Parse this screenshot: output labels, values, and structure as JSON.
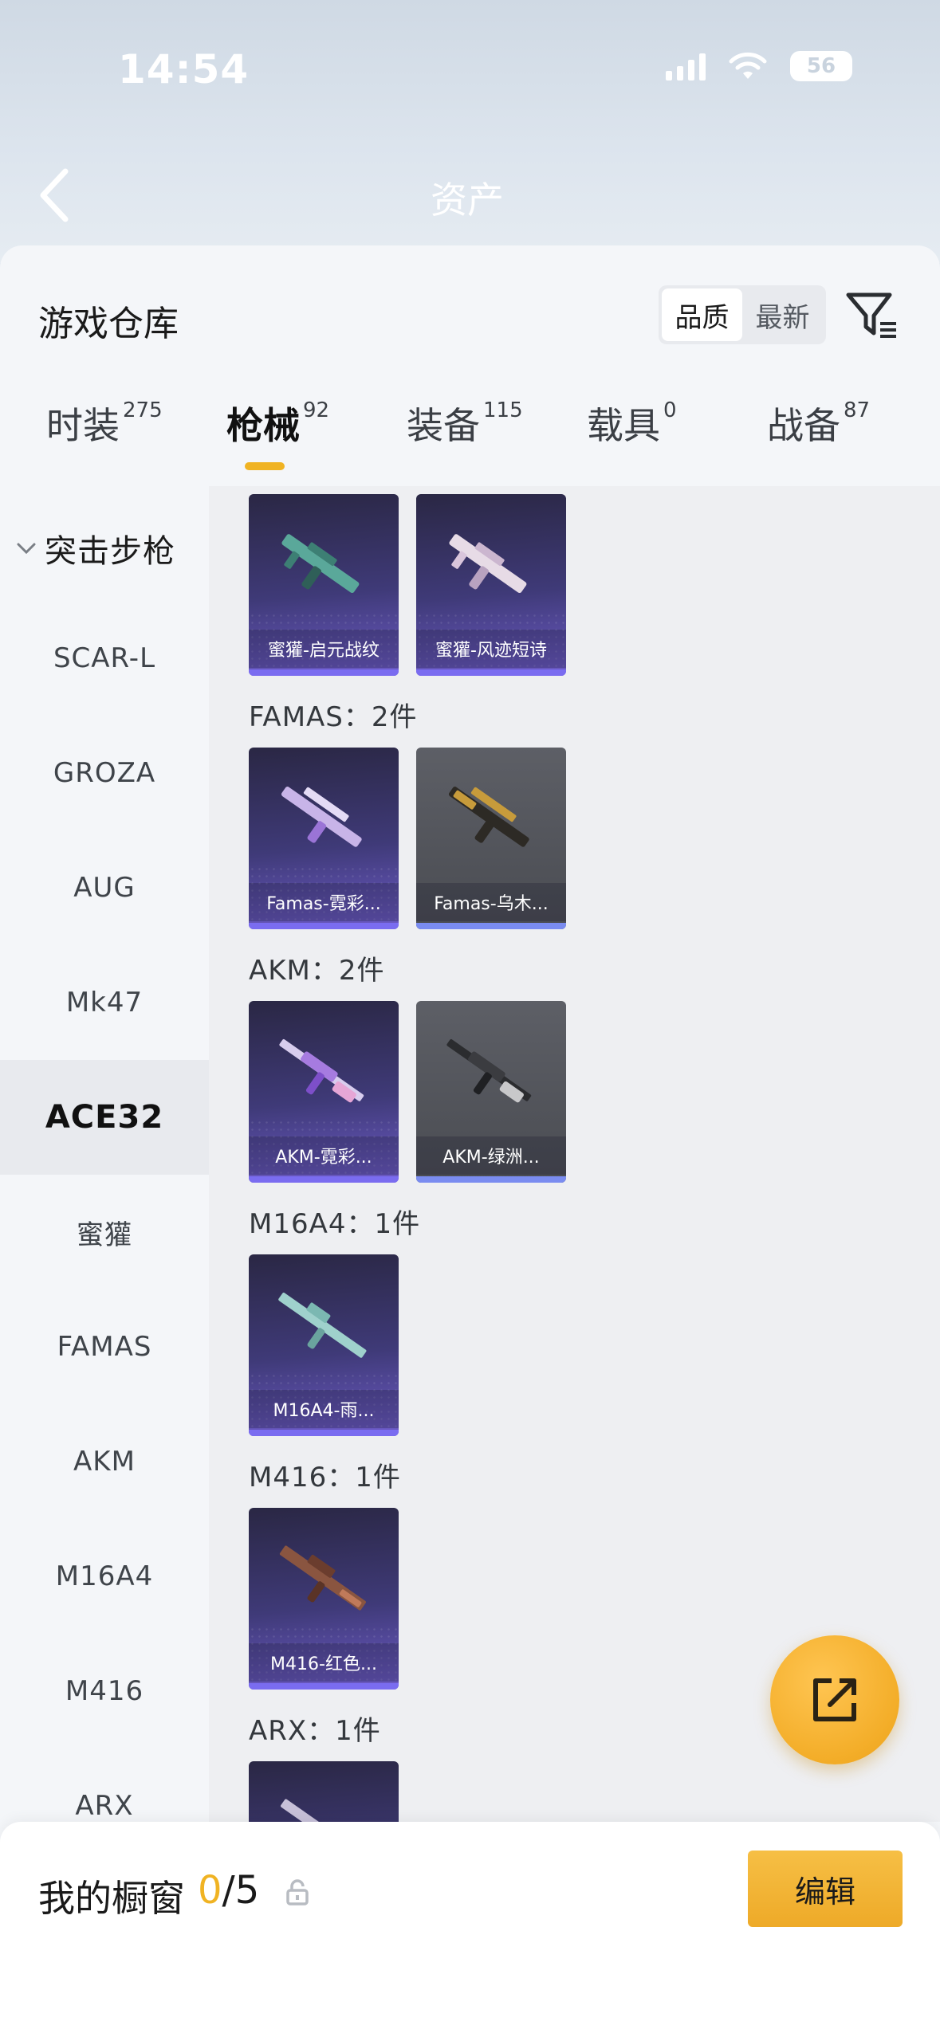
{
  "status_bar": {
    "time": "14:54",
    "battery": "56"
  },
  "nav": {
    "title": "资产"
  },
  "sheet": {
    "title": "游戏仓库"
  },
  "sort": {
    "options": [
      "品质",
      "最新"
    ],
    "selected": "品质"
  },
  "tabs": [
    {
      "label": "时装",
      "count": "275"
    },
    {
      "label": "枪械",
      "count": "92",
      "active": true
    },
    {
      "label": "装备",
      "count": "115"
    },
    {
      "label": "载具",
      "count": "0"
    },
    {
      "label": "战备",
      "count": "87"
    }
  ],
  "sidebar": {
    "group": "突击步枪",
    "items": [
      "SCAR-L",
      "GROZA",
      "AUG",
      "Mk47",
      "ACE32",
      "蜜獾",
      "FAMAS",
      "AKM",
      "M16A4",
      "M416",
      "ARX"
    ],
    "active": "ACE32"
  },
  "content": {
    "groups": [
      {
        "label": "",
        "items": [
          {
            "name": "蜜獾-启元战纹"
          },
          {
            "name": "蜜獾-风迹短诗"
          }
        ]
      },
      {
        "label": "FAMAS：2件",
        "items": [
          {
            "name": "Famas-霓彩..."
          },
          {
            "name": "Famas-乌木..."
          }
        ]
      },
      {
        "label": "AKM：2件",
        "items": [
          {
            "name": "AKM-霓彩..."
          },
          {
            "name": "AKM-绿洲..."
          }
        ]
      },
      {
        "label": "M16A4：1件",
        "items": [
          {
            "name": "M16A4-雨..."
          }
        ]
      },
      {
        "label": "M416：1件",
        "items": [
          {
            "name": "M416-红色..."
          }
        ]
      },
      {
        "label": "ARX：1件",
        "items": [
          {
            "name": ""
          }
        ]
      }
    ]
  },
  "showcase": {
    "label": "我的橱窗",
    "used": "0",
    "total": "/5",
    "edit_label": "编辑"
  },
  "colors": {
    "accent": "#f0b323",
    "card_purple": "#4a3f8f",
    "card_grey": "#55575d"
  }
}
